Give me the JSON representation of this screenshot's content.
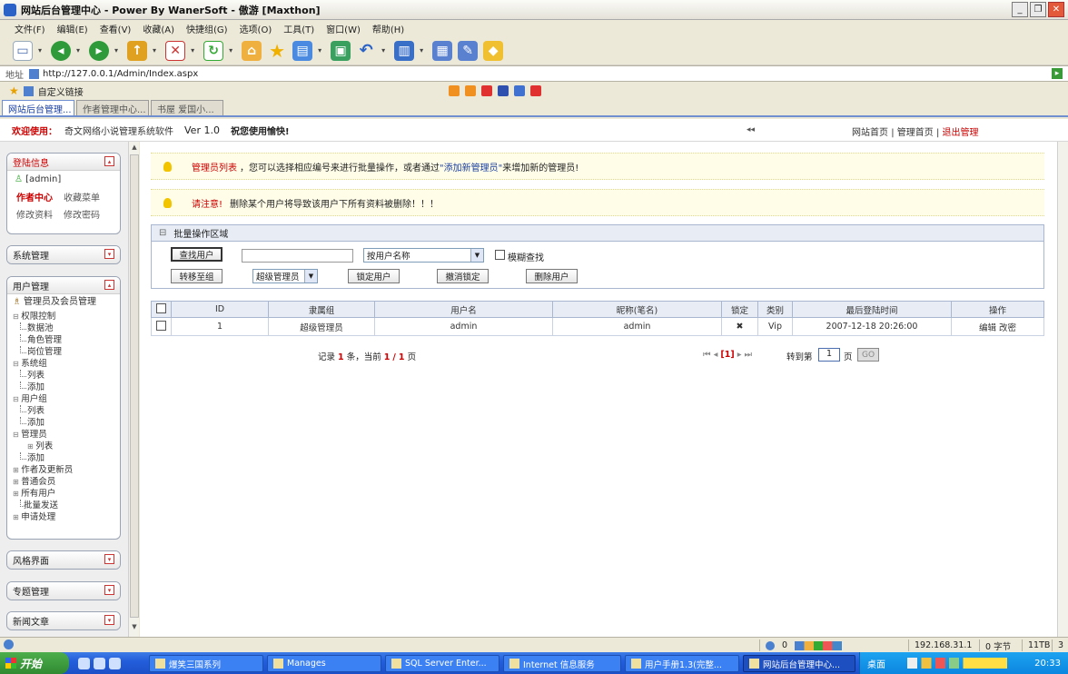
{
  "window": {
    "title": "网站后台管理中心 - Power By WanerSoft - 傲游 [Maxthon]"
  },
  "menu": [
    "文件(F)",
    "编辑(E)",
    "查看(V)",
    "收藏(A)",
    "快捷组(G)",
    "选项(O)",
    "工具(T)",
    "窗口(W)",
    "帮助(H)"
  ],
  "toolbar_icons": [
    "new-page-icon",
    "back-icon",
    "forward-icon",
    "up-icon",
    "stop-icon",
    "refresh-icon",
    "home-icon",
    "favorites-icon",
    "groups-icon",
    "history-icon",
    "undo-icon",
    "options-icon",
    "view-icon",
    "edit-icon",
    "plugin-icon"
  ],
  "address": {
    "label": "地址",
    "url": "http://127.0.0.1/Admin/Index.aspx"
  },
  "favbar": {
    "custom_links": "自定义链接"
  },
  "tabs": [
    "网站后台管理...",
    "作者管理中心...",
    "书屋 爱国小..."
  ],
  "header": {
    "welcome": "欢迎使用：",
    "system_name": "奇文网络小说管理系统软件",
    "version": "Ver 1.0",
    "hint": "祝您使用愉快!",
    "collapse": "◂◂",
    "links": {
      "site_home": "网站首页",
      "admin_home": "管理首页",
      "logout": "退出管理",
      "sep": "|"
    }
  },
  "sidebar": {
    "login_panel": {
      "title": "登陆信息",
      "user": "[admin]",
      "links": [
        "作者中心",
        "收藏菜单",
        "修改资料",
        "修改密码"
      ]
    },
    "system_panel": {
      "title": "系统管理"
    },
    "user_panel": {
      "title": "用户管理",
      "subtitle": "管理员及会员管理",
      "tree": [
        {
          "level": 0,
          "label": "权限控制",
          "open": true
        },
        {
          "level": 1,
          "label": "数据池"
        },
        {
          "level": 1,
          "label": "角色管理"
        },
        {
          "level": 1,
          "label": "岗位管理"
        },
        {
          "level": 0,
          "label": "系统组",
          "open": true
        },
        {
          "level": 1,
          "label": "列表"
        },
        {
          "level": 1,
          "label": "添加"
        },
        {
          "level": 0,
          "label": "用户组",
          "open": true
        },
        {
          "level": 1,
          "label": "列表"
        },
        {
          "level": 1,
          "label": "添加"
        },
        {
          "level": 0,
          "label": "管理员",
          "open": true
        },
        {
          "level": "1p",
          "label": "列表"
        },
        {
          "level": 1,
          "label": "添加"
        },
        {
          "level": "p",
          "label": "作者及更新员"
        },
        {
          "level": "p",
          "label": "普通会员"
        },
        {
          "level": "p",
          "label": "所有用户"
        },
        {
          "level": 1,
          "label": "批量发送"
        },
        {
          "level": "p",
          "label": "申请处理"
        }
      ]
    },
    "style_panel": {
      "title": "风格界面"
    },
    "topic_panel": {
      "title": "专题管理"
    },
    "news_panel": {
      "title": "新闻文章"
    }
  },
  "notices": {
    "n1": {
      "red": "管理员列表",
      "text1": "，您可以选择相应编号来进行批量操作，或者通过",
      "link": "\"添加新管理员\"",
      "text2": "来增加新的管理员!"
    },
    "n2": {
      "red": "请注意!",
      "text": "删除某个用户将导致该用户下所有资料被删除！！！"
    }
  },
  "batch": {
    "title": "批量操作区域",
    "find_button": "查找用户",
    "search_value": "",
    "search_by": "按用户名称",
    "fuzzy_label": "模糊查找",
    "move_button": "转移至组",
    "group_select": "超级管理员",
    "lock_button": "锁定用户",
    "unlock_button": "撤消锁定",
    "delete_button": "删除用户"
  },
  "table": {
    "headers": [
      "ID",
      "隶属组",
      "用户名",
      "昵称(笔名)",
      "锁定",
      "类别",
      "最后登陆时间",
      "操作"
    ],
    "rows": [
      {
        "id": "1",
        "group": "超级管理员",
        "username": "admin",
        "nickname": "admin",
        "locked": "✖",
        "category": "Vip",
        "last_login": "2007-12-18 20:26:00",
        "ops": "编辑 改密"
      }
    ]
  },
  "pager": {
    "record_prefix": "记录",
    "count": "1",
    "record_mid": "条，当前",
    "current": "1",
    "slash": "/",
    "total": "1",
    "page_suffix": "页",
    "nav_left": "⏮ ◂",
    "current_bracket": "[1]",
    "nav_right": "▸ ⏭",
    "jump_label": "转到第",
    "jump_value": "1",
    "page_unit": "页",
    "go": "GO"
  },
  "statusbar": {
    "count": "0",
    "ip": "192.168.31.1",
    "bytes": "0 字节",
    "mem": "11TB",
    "num": "3"
  },
  "taskbar": {
    "start": "开始",
    "tasks": [
      "爆笑三国系列",
      "Manages",
      "SQL Server Enter...",
      "Internet 信息服务",
      "用户手册1.3(完整...",
      "网站后台管理中心..."
    ],
    "tray_label": "桌面",
    "clock": "20:33"
  }
}
